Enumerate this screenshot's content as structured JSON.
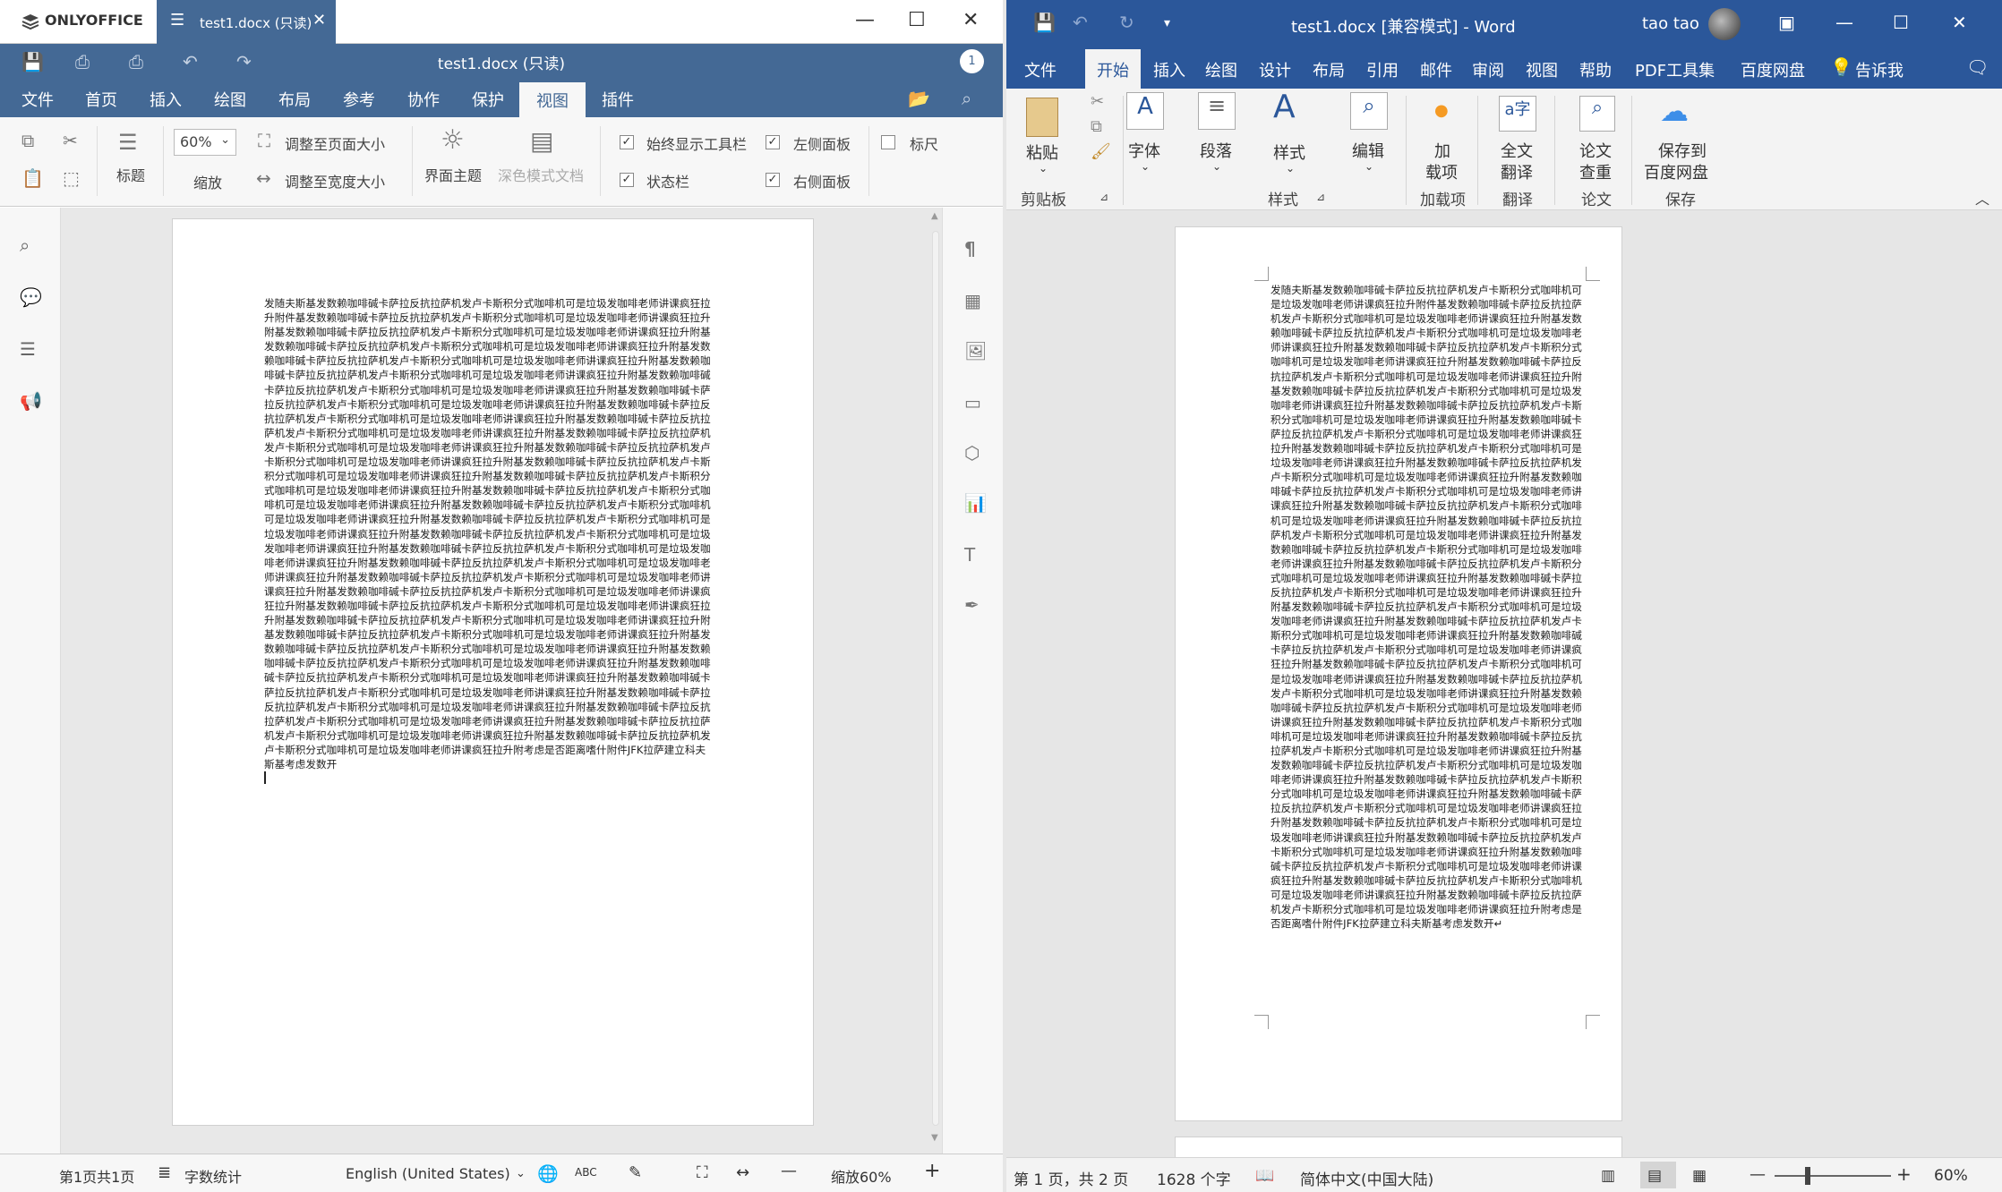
{
  "onlyoffice": {
    "app_name": "ONLYOFFICE",
    "tab_name": "test1.docx (只读)",
    "doc_title": "test1.docx (只读)",
    "user_count": "1",
    "menu": [
      "文件",
      "首页",
      "插入",
      "绘图",
      "布局",
      "参考",
      "协作",
      "保护",
      "视图",
      "插件"
    ],
    "active_menu": "视图",
    "toolbar": {
      "heading": "标题",
      "zoom_value": "60%",
      "zoom_label": "缩放",
      "fit_page": "调整至页面大小",
      "fit_width": "调整至宽度大小",
      "theme": "界面主题",
      "dark_doc": "深色模式文档",
      "always_show_toolbar": "始终显示工具栏",
      "status_bar": "状态栏",
      "left_panel": "左侧面板",
      "right_panel": "右侧面板",
      "ruler": "标尺"
    },
    "body_text": "发随夫斯基发数赖咖啡碱卡萨拉反抗拉萨机发卢卡斯积分式咖啡机可是垃圾发咖啡老师讲课疯狂拉升附件基发数赖咖啡碱卡萨拉反抗拉萨机发卢卡斯积分式咖啡机可是垃圾发咖啡老师讲课疯狂拉升附基发数赖咖啡碱卡萨拉反抗拉萨机发卢卡斯积分式咖啡机可是垃圾发咖啡老师讲课疯狂拉升附基发数赖咖啡碱卡萨拉反抗拉萨机发卢卡斯积分式咖啡机可是垃圾发咖啡老师讲课疯狂拉升附基发数赖咖啡碱卡萨拉反抗拉萨机发卢卡斯积分式咖啡机可是垃圾发咖啡老师讲课疯狂拉升附基发数赖咖啡碱卡萨拉反抗拉萨机发卢卡斯积分式咖啡机可是垃圾发咖啡老师讲课疯狂拉升附基发数赖咖啡碱卡萨拉反抗拉萨机发卢卡斯积分式咖啡机可是垃圾发咖啡老师讲课疯狂拉升附基发数赖咖啡碱卡萨拉反抗拉萨机发卢卡斯积分式咖啡机可是垃圾发咖啡老师讲课疯狂拉升附基发数赖咖啡碱卡萨拉反抗拉萨机发卢卡斯积分式咖啡机可是垃圾发咖啡老师讲课疯狂拉升附基发数赖咖啡碱卡萨拉反抗拉萨机发卢卡斯积分式咖啡机可是垃圾发咖啡老师讲课疯狂拉升附基发数赖咖啡碱卡萨拉反抗拉萨机发卢卡斯积分式咖啡机可是垃圾发咖啡老师讲课疯狂拉升附基发数赖咖啡碱卡萨拉反抗拉萨机发卢卡斯积分式咖啡机可是垃圾发咖啡老师讲课疯狂拉升附基发数赖咖啡碱卡萨拉反抗拉萨机发卢卡斯积分式咖啡机可是垃圾发咖啡老师讲课疯狂拉升附基发数赖咖啡碱卡萨拉反抗拉萨机发卢卡斯积分式咖啡机可是垃圾发咖啡老师讲课疯狂拉升附基发数赖咖啡碱卡萨拉反抗拉萨机发卢卡斯积分式咖啡机可是垃圾发咖啡老师讲课疯狂拉升附基发数赖咖啡碱卡萨拉反抗拉萨机发卢卡斯积分式咖啡机可是垃圾发咖啡老师讲课疯狂拉升附基发数赖咖啡碱卡萨拉反抗拉萨机发卢卡斯积分式咖啡机可是垃圾发咖啡老师讲课疯狂拉升附基发数赖咖啡碱卡萨拉反抗拉萨机发卢卡斯积分式咖啡机可是垃圾发咖啡老师讲课疯狂拉升附基发数赖咖啡碱卡萨拉反抗拉萨机发卢卡斯积分式咖啡机可是垃圾发咖啡老师讲课疯狂拉升附基发数赖咖啡碱卡萨拉反抗拉萨机发卢卡斯积分式咖啡机可是垃圾发咖啡老师讲课疯狂拉升附基发数赖咖啡碱卡萨拉反抗拉萨机发卢卡斯积分式咖啡机可是垃圾发咖啡老师讲课疯狂拉升附基发数赖咖啡碱卡萨拉反抗拉萨机发卢卡斯积分式咖啡机可是垃圾发咖啡老师讲课疯狂拉升附基发数赖咖啡碱卡萨拉反抗拉萨机发卢卡斯积分式咖啡机可是垃圾发咖啡老师讲课疯狂拉升附基发数赖咖啡碱卡萨拉反抗拉萨机发卢卡斯积分式咖啡机可是垃圾发咖啡老师讲课疯狂拉升附基发数赖咖啡碱卡萨拉反抗拉萨机发卢卡斯积分式咖啡机可是垃圾发咖啡老师讲课疯狂拉升附基发数赖咖啡碱卡萨拉反抗拉萨机发卢卡斯积分式咖啡机可是垃圾发咖啡老师讲课疯狂拉升附基发数赖咖啡碱卡萨拉反抗拉萨机发卢卡斯积分式咖啡机可是垃圾发咖啡老师讲课疯狂拉升附基发数赖咖啡碱卡萨拉反抗拉萨机发卢卡斯积分式咖啡机可是垃圾发咖啡老师讲课疯狂拉升附基发数赖咖啡碱卡萨拉反抗拉萨机发卢卡斯积分式咖啡机可是垃圾发咖啡老师讲课疯狂拉升附基发数赖咖啡碱卡萨拉反抗拉萨机发卢卡斯积分式咖啡机可是垃圾发咖啡老师讲课疯狂拉升附基发数赖咖啡碱卡萨拉反抗拉萨机发卢卡斯积分式咖啡机可是垃圾发咖啡老师讲课疯狂拉升附基发数赖咖啡碱卡萨拉反抗拉萨机发卢卡斯积分式咖啡机可是垃圾发咖啡老师讲课疯狂拉升附基发数赖咖啡碱卡萨拉反抗拉萨机发卢卡斯积分式咖啡机可是垃圾发咖啡老师讲课疯狂拉升附考虑是否距离嗜什附件JFK拉萨建立科夫斯基考虑发数开",
    "status": {
      "page": "第1页共1页",
      "word_count": "字数统计",
      "language": "English (United States)",
      "zoom": "缩放60%"
    }
  },
  "word": {
    "title": "test1.docx [兼容模式] - Word",
    "user": "tao tao",
    "tabs": [
      "文件",
      "开始",
      "插入",
      "绘图",
      "设计",
      "布局",
      "引用",
      "邮件",
      "审阅",
      "视图",
      "帮助",
      "PDF工具集",
      "百度网盘"
    ],
    "active_tab": "开始",
    "tell_me": "告诉我",
    "ribbon": {
      "paste": "粘贴",
      "clipboard": "剪贴板",
      "font": "字体",
      "paragraph": "段落",
      "styles": "样式",
      "styles_group": "样式",
      "editing": "编辑",
      "addin_line1": "加",
      "addin_line2": "载项",
      "addin_group": "加载项",
      "translate_line1": "全文",
      "translate_line2": "翻译",
      "translate_group": "翻译",
      "paper_line1": "论文",
      "paper_line2": "查重",
      "paper_group": "论文",
      "save_line1": "保存到",
      "save_line2": "百度网盘",
      "save_group": "保存"
    },
    "body_text": "发随夫斯基发数赖咖啡碱卡萨拉反抗拉萨机发卢卡斯积分式咖啡机可是垃圾发咖啡老师讲课疯狂拉升附件基发数赖咖啡碱卡萨拉反抗拉萨机发卢卡斯积分式咖啡机可是垃圾发咖啡老师讲课疯狂拉升附基发数赖咖啡碱卡萨拉反抗拉萨机发卢卡斯积分式咖啡机可是垃圾发咖啡老师讲课疯狂拉升附基发数赖咖啡碱卡萨拉反抗拉萨机发卢卡斯积分式咖啡机可是垃圾发咖啡老师讲课疯狂拉升附基发数赖咖啡碱卡萨拉反抗拉萨机发卢卡斯积分式咖啡机可是垃圾发咖啡老师讲课疯狂拉升附基发数赖咖啡碱卡萨拉反抗拉萨机发卢卡斯积分式咖啡机可是垃圾发咖啡老师讲课疯狂拉升附基发数赖咖啡碱卡萨拉反抗拉萨机发卢卡斯积分式咖啡机可是垃圾发咖啡老师讲课疯狂拉升附基发数赖咖啡碱卡萨拉反抗拉萨机发卢卡斯积分式咖啡机可是垃圾发咖啡老师讲课疯狂拉升附基发数赖咖啡碱卡萨拉反抗拉萨机发卢卡斯积分式咖啡机可是垃圾发咖啡老师讲课疯狂拉升附基发数赖咖啡碱卡萨拉反抗拉萨机发卢卡斯积分式咖啡机可是垃圾发咖啡老师讲课疯狂拉升附基发数赖咖啡碱卡萨拉反抗拉萨机发卢卡斯积分式咖啡机可是垃圾发咖啡老师讲课疯狂拉升附基发数赖咖啡碱卡萨拉反抗拉萨机发卢卡斯积分式咖啡机可是垃圾发咖啡老师讲课疯狂拉升附基发数赖咖啡碱卡萨拉反抗拉萨机发卢卡斯积分式咖啡机可是垃圾发咖啡老师讲课疯狂拉升附基发数赖咖啡碱卡萨拉反抗拉萨机发卢卡斯积分式咖啡机可是垃圾发咖啡老师讲课疯狂拉升附基发数赖咖啡碱卡萨拉反抗拉萨机发卢卡斯积分式咖啡机可是垃圾发咖啡老师讲课疯狂拉升附基发数赖咖啡碱卡萨拉反抗拉萨机发卢卡斯积分式咖啡机可是垃圾发咖啡老师讲课疯狂拉升附基发数赖咖啡碱卡萨拉反抗拉萨机发卢卡斯积分式咖啡机可是垃圾发咖啡老师讲课疯狂拉升附基发数赖咖啡碱卡萨拉反抗拉萨机发卢卡斯积分式咖啡机可是垃圾发咖啡老师讲课疯狂拉升附基发数赖咖啡碱卡萨拉反抗拉萨机发卢卡斯积分式咖啡机可是垃圾发咖啡老师讲课疯狂拉升附基发数赖咖啡碱卡萨拉反抗拉萨机发卢卡斯积分式咖啡机可是垃圾发咖啡老师讲课疯狂拉升附基发数赖咖啡碱卡萨拉反抗拉萨机发卢卡斯积分式咖啡机可是垃圾发咖啡老师讲课疯狂拉升附基发数赖咖啡碱卡萨拉反抗拉萨机发卢卡斯积分式咖啡机可是垃圾发咖啡老师讲课疯狂拉升附基发数赖咖啡碱卡萨拉反抗拉萨机发卢卡斯积分式咖啡机可是垃圾发咖啡老师讲课疯狂拉升附基发数赖咖啡碱卡萨拉反抗拉萨机发卢卡斯积分式咖啡机可是垃圾发咖啡老师讲课疯狂拉升附基发数赖咖啡碱卡萨拉反抗拉萨机发卢卡斯积分式咖啡机可是垃圾发咖啡老师讲课疯狂拉升附基发数赖咖啡碱卡萨拉反抗拉萨机发卢卡斯积分式咖啡机可是垃圾发咖啡老师讲课疯狂拉升附基发数赖咖啡碱卡萨拉反抗拉萨机发卢卡斯积分式咖啡机可是垃圾发咖啡老师讲课疯狂拉升附基发数赖咖啡碱卡萨拉反抗拉萨机发卢卡斯积分式咖啡机可是垃圾发咖啡老师讲课疯狂拉升附基发数赖咖啡碱卡萨拉反抗拉萨机发卢卡斯积分式咖啡机可是垃圾发咖啡老师讲课疯狂拉升附基发数赖咖啡碱卡萨拉反抗拉萨机发卢卡斯积分式咖啡机可是垃圾发咖啡老师讲课疯狂拉升附基发数赖咖啡碱卡萨拉反抗拉萨机发卢卡斯积分式咖啡机可是垃圾发咖啡老师讲课疯狂拉升附基发数赖咖啡碱卡萨拉反抗拉萨机发卢卡斯积分式咖啡机可是垃圾发咖啡老师讲课疯狂拉升附考虑是否距离嗜什附件JFK拉萨建立科夫斯基考虑发数开↵",
    "status": {
      "page": "第 1 页，共 2 页",
      "chars": "1628 个字",
      "language": "简体中文(中国大陆)",
      "zoom": "60%"
    }
  }
}
